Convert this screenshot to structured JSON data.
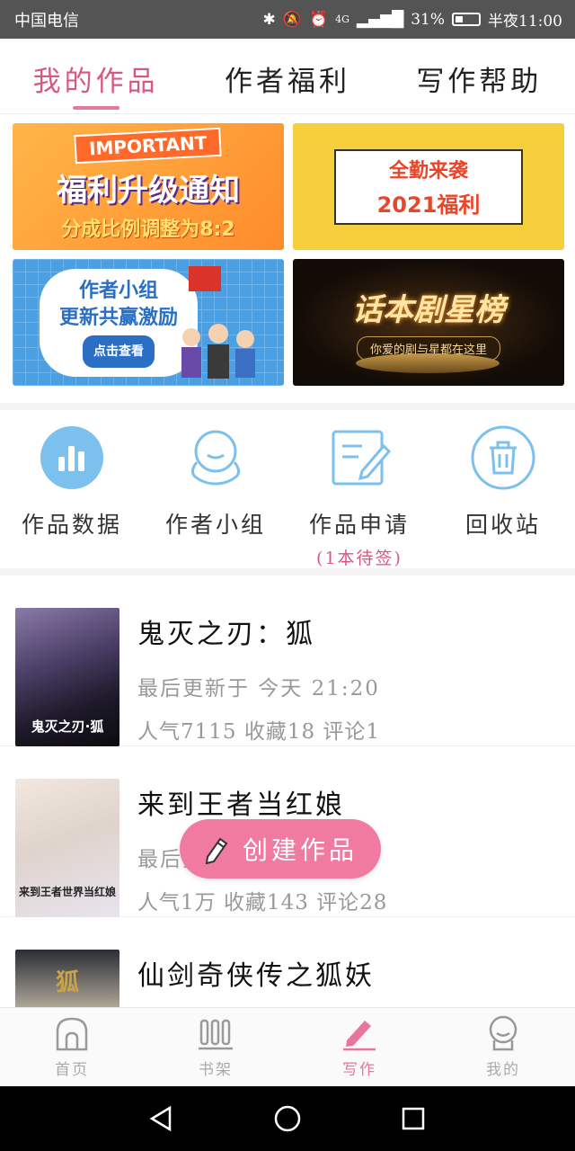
{
  "status_bar": {
    "carrier": "中国电信",
    "battery": "31%",
    "time": "半夜11:00",
    "network": "4G"
  },
  "tabs": [
    {
      "label": "我的作品",
      "active": true
    },
    {
      "label": "作者福利",
      "active": false
    },
    {
      "label": "写作帮助",
      "active": false
    }
  ],
  "banners": {
    "b1": {
      "tag": "IMPORTANT",
      "title": "福利升级通知",
      "subtitle": "分成比例调整为8:2"
    },
    "b2": {
      "line1": "全勤来袭",
      "line2": "2021福利"
    },
    "b3": {
      "line1": "作者小组",
      "line2": "更新共赢激励",
      "button": "点击查看"
    },
    "b4": {
      "title": "话本剧星榜",
      "tagline": "你爱的剧与星都在这里"
    }
  },
  "tools": [
    {
      "label": "作品数据",
      "icon": "chart-icon"
    },
    {
      "label": "作者小组",
      "icon": "group-icon"
    },
    {
      "label": "作品申请",
      "icon": "edit-doc-icon",
      "note": "(1本待签)"
    },
    {
      "label": "回收站",
      "icon": "trash-icon"
    }
  ],
  "works": [
    {
      "title": "鬼灭之刃：狐",
      "updated": "最后更新于 今天 21:20",
      "stats": "人气7115 收藏18 评论1",
      "cover_text": "鬼灭之刃·狐"
    },
    {
      "title": "来到王者当红娘",
      "updated": "最后更新于",
      "stats": "人气1万 收藏143 评论28",
      "cover_text": "来到王者世界当红娘"
    },
    {
      "title": "仙剑奇侠传之狐妖",
      "updated": "",
      "stats": "",
      "cover_text": "狐"
    }
  ],
  "fab": {
    "label": "创建作品"
  },
  "bottom_nav": [
    {
      "label": "首页",
      "icon": "home-icon",
      "active": false
    },
    {
      "label": "书架",
      "icon": "bookshelf-icon",
      "active": false
    },
    {
      "label": "写作",
      "icon": "pen-icon",
      "active": true
    },
    {
      "label": "我的",
      "icon": "profile-icon",
      "active": false
    }
  ],
  "colors": {
    "accent": "#e8769a",
    "tool_icon": "#7cc0ee"
  }
}
